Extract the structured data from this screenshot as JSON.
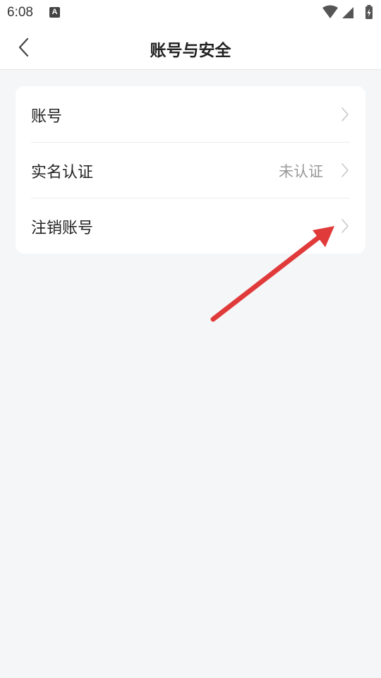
{
  "status_bar": {
    "time": "6:08",
    "icons": [
      "a-notification-icon",
      "wifi-icon",
      "cellular-signal-icon",
      "battery-charging-icon"
    ]
  },
  "header": {
    "title": "账号与安全",
    "back_icon": "chevron-left-icon"
  },
  "settings": {
    "items": [
      {
        "label": "账号",
        "value": ""
      },
      {
        "label": "实名认证",
        "value": "未认证"
      },
      {
        "label": "注销账号",
        "value": ""
      }
    ]
  },
  "annotation": {
    "color": "#e03a3a",
    "icon": "red-arrow-pointer-icon"
  },
  "colors": {
    "background": "#f5f6f8",
    "card": "#ffffff",
    "secondary_text": "#999999",
    "chevron": "#c8c8c8"
  }
}
